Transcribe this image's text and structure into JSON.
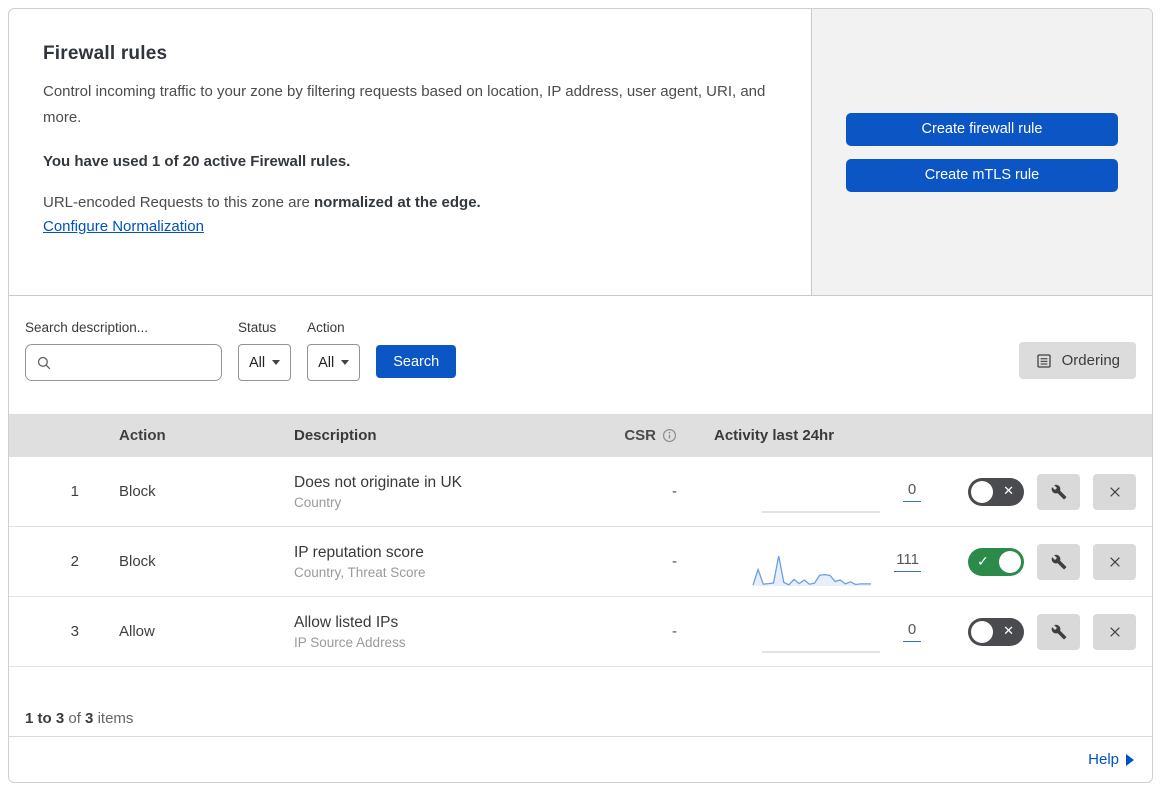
{
  "header": {
    "title": "Firewall rules",
    "description": "Control incoming traffic to your zone by filtering requests based on location, IP address, user agent, URI, and more.",
    "usage_bold": "You have used 1 of 20 active Firewall rules.",
    "normalization_prefix": "URL-encoded Requests to this zone are",
    "normalization_bold": "normalized at the edge.",
    "normalization_link": "Configure Normalization",
    "create_firewall_button": "Create firewall rule",
    "create_mtls_button": "Create mTLS rule"
  },
  "filters": {
    "search_label": "Search description...",
    "status_label": "Status",
    "status_value": "All",
    "action_label": "Action",
    "action_value": "All",
    "search_button": "Search",
    "ordering_button": "Ordering"
  },
  "table": {
    "columns": {
      "action": "Action",
      "description": "Description",
      "csr": "CSR",
      "activity": "Activity last 24hr"
    },
    "rows": [
      {
        "num": "1",
        "action": "Block",
        "description": "Does not originate in UK",
        "fields": "Country",
        "csr": "-",
        "count": "0",
        "enabled": false,
        "sparkline": [
          0,
          0,
          0,
          0,
          0,
          0,
          0,
          0,
          0,
          0,
          0,
          0,
          0,
          0,
          0,
          0,
          0,
          0,
          0,
          0,
          0,
          0,
          0,
          0
        ]
      },
      {
        "num": "2",
        "action": "Block",
        "description": "IP reputation score",
        "fields": "Country, Threat Score",
        "csr": "-",
        "count": "111",
        "enabled": true,
        "sparkline": [
          3,
          55,
          6,
          8,
          10,
          100,
          12,
          4,
          22,
          8,
          20,
          6,
          10,
          36,
          38,
          35,
          15,
          20,
          7,
          14,
          5,
          7,
          7,
          7
        ]
      },
      {
        "num": "3",
        "action": "Allow",
        "description": "Allow listed IPs",
        "fields": "IP Source Address",
        "csr": "-",
        "count": "0",
        "enabled": false,
        "sparkline": [
          0,
          0,
          0,
          0,
          0,
          0,
          0,
          0,
          0,
          0,
          0,
          0,
          0,
          0,
          0,
          0,
          0,
          0,
          0,
          0,
          0,
          0,
          0,
          0
        ]
      }
    ]
  },
  "footer": {
    "range_bold": "1 to 3",
    "of_text": "of",
    "total_bold": "3",
    "items_text": "items",
    "help_label": "Help"
  },
  "icons": {
    "toggle_check": "✓",
    "toggle_x": "✕"
  },
  "colors": {
    "accent_blue": "#0b55c4",
    "link_blue": "#0051c3",
    "toggle_on_green": "#2c8a4b",
    "toggle_off_gray": "#4a4b4f",
    "spark_line": "#6d9ee3",
    "spark_fill": "rgba(109,158,227,0.16)",
    "spark_flat": "#c6c6c6",
    "table_header_bg": "#dfdfdf",
    "panel_bg": "#f2f2f2"
  }
}
